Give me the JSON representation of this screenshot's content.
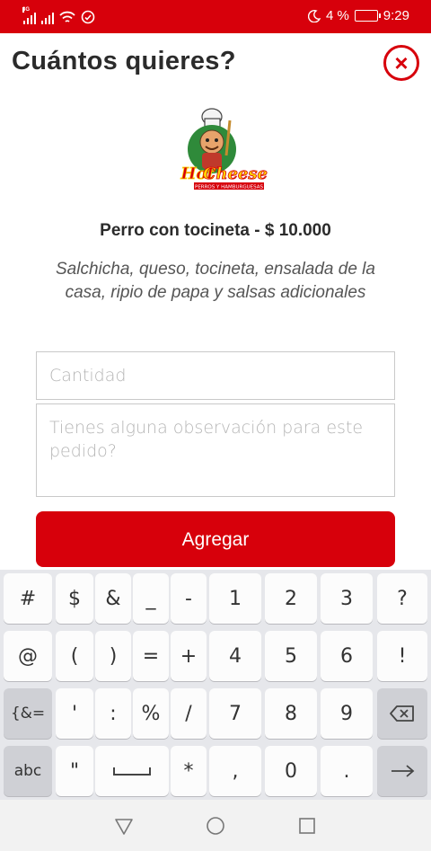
{
  "status_bar": {
    "network_tag": "3G",
    "battery_percent": "4 %",
    "time": "9:29",
    "icons": [
      "signal-icon",
      "signal-icon",
      "wifi-icon",
      "sync-icon",
      "moon-icon",
      "battery-icon"
    ],
    "color": "#d7000b"
  },
  "header": {
    "title": "Cuántos quieres?",
    "close_icon": "close-icon"
  },
  "logo": {
    "name": "Hot Cheese",
    "line1": "Hot",
    "line2": "Cheese",
    "tagline": "PERROS Y HAMBURGUESAS"
  },
  "product": {
    "name": "Perro con tocineta - $ 10.000",
    "description": "Salchicha, queso, tocineta, ensalada de la casa, ripio de papa y salsas adicionales"
  },
  "form": {
    "quantity_placeholder": "Cantidad",
    "notes_placeholder": "Tienes alguna observación para este pedido?",
    "submit_label": "Agregar",
    "accent": "#d7000b"
  },
  "keyboard": {
    "row1": [
      "#",
      "$",
      "&",
      "_",
      "-",
      "1",
      "2",
      "3",
      "?"
    ],
    "row2": [
      "@",
      "(",
      ")",
      "=",
      "+",
      "4",
      "5",
      "6",
      "!"
    ],
    "row3": [
      "{&=",
      "'",
      ":",
      "%",
      "/",
      "7",
      "8",
      "9",
      "backspace-icon"
    ],
    "row4": [
      "abc",
      "\"",
      "space-icon",
      "*",
      ",",
      "0",
      ".",
      "enter-arrow-icon"
    ]
  },
  "nav_bar": {
    "icons": [
      "back-icon",
      "home-icon",
      "recents-icon"
    ]
  }
}
